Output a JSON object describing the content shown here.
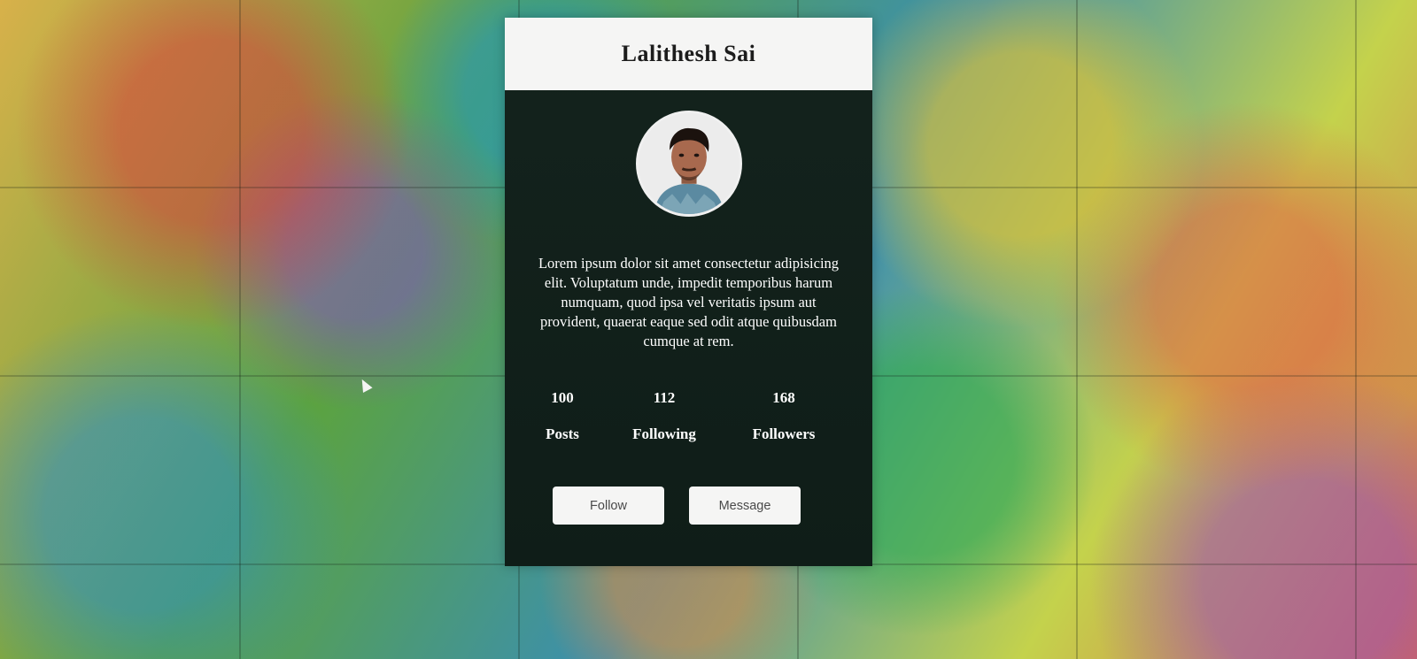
{
  "profile": {
    "name": "Lalithesh Sai",
    "bio": "Lorem ipsum dolor sit amet consectetur adipisicing elit. Voluptatum unde, impedit temporibus harum numquam, quod ipsa vel veritatis ipsum aut provident, quaerat eaque sed odit atque quibusdam cumque at rem."
  },
  "stats": {
    "posts": {
      "value": "100",
      "label": "Posts"
    },
    "following": {
      "value": "112",
      "label": "Following"
    },
    "followers": {
      "value": "168",
      "label": "Followers"
    }
  },
  "actions": {
    "follow_label": "Follow",
    "message_label": "Message"
  },
  "colors": {
    "card_background": "#12201b",
    "header_background": "#f5f5f4",
    "button_background": "#f5f5f4"
  }
}
